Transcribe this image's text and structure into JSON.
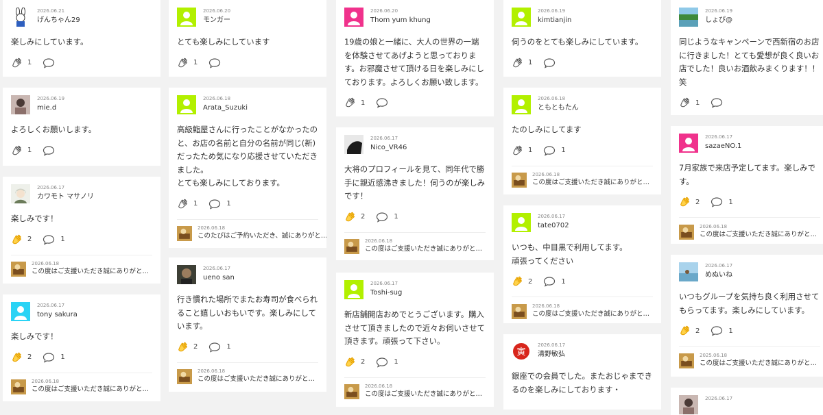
{
  "reply_text": "この度はご支援いただき誠にありがと…",
  "reply_text_alt": "このたびはご予約いただき、誠にありがと…",
  "colors": {
    "accent_lime": "#b2f000",
    "accent_pink": "#f0328c",
    "accent_cyan": "#2ad3f5",
    "clap_active": "#f5b400"
  },
  "posts": [
    {
      "id": "p1",
      "date": "2026.06.21",
      "name": "げんちゃん29",
      "avatar": "bunny-icon",
      "text": "楽しみにしています。",
      "claps": "1",
      "comments": "",
      "reply_date": "",
      "active": false
    },
    {
      "id": "p2",
      "date": "2026.06.19",
      "name": "mie.d",
      "avatar": "photo-avatar",
      "text": "よろしくお願いします。",
      "claps": "1",
      "comments": "",
      "reply_date": "",
      "active": false
    },
    {
      "id": "p3",
      "date": "2026.06.17",
      "name": "カワモト マサノリ",
      "avatar": "anime-avatar",
      "text": "楽しみです！",
      "claps": "2",
      "comments": "1",
      "reply_date": "2026.06.18",
      "active": true
    },
    {
      "id": "p4",
      "date": "2026.06.17",
      "name": "tony sakura",
      "avatar": "cyan-user-icon",
      "text": "楽しみです！",
      "claps": "2",
      "comments": "1",
      "reply_date": "2026.06.18",
      "active": true
    },
    {
      "id": "p5",
      "date": "2026.06.20",
      "name": "モンガー",
      "avatar": "lime-user-icon",
      "text": "とても楽しみにしています",
      "claps": "1",
      "comments": "",
      "reply_date": "",
      "active": false
    },
    {
      "id": "p6",
      "date": "2026.06.18",
      "name": "Arata_Suzuki",
      "avatar": "lime-user-icon",
      "text": "高級鮨屋さんに行ったことがなかったのと、お店の名前と自分の名前が同じ(新)だったため気になり応援させていただきました。\nとても楽しみにしております。",
      "claps": "1",
      "comments": "1",
      "reply_date": "2026.06.18",
      "active": false,
      "alt_reply": true
    },
    {
      "id": "p7",
      "date": "2026.06.17",
      "name": "ueno san",
      "avatar": "photo-avatar-dark",
      "text": "行き慣れた場所でまたお寿司が食べられること嬉しいおもいです。楽しみにしています。",
      "claps": "2",
      "comments": "1",
      "reply_date": "2026.06.18",
      "active": true
    },
    {
      "id": "p8",
      "date": "2026.06.20",
      "name": "Thom yum khung",
      "avatar": "pink-user-icon",
      "text": "19歳の娘と一緒に、大人の世界の一端を体験させてあげようと思っております。お邪魔させて頂ける日を楽しみにしております。よろしくお願い致します。",
      "claps": "1",
      "comments": "",
      "reply_date": "",
      "active": false
    },
    {
      "id": "p9",
      "date": "2026.06.17",
      "name": "Nico_VR46",
      "avatar": "photo-avatar-bw",
      "text": "大将のプロフィールを見て、同年代で勝手に親近感沸きました！伺うのが楽しみです！",
      "claps": "2",
      "comments": "1",
      "reply_date": "2026.06.18",
      "active": true
    },
    {
      "id": "p10",
      "date": "2026.06.17",
      "name": "Toshi-sug",
      "avatar": "lime-user-icon",
      "text": "新店舗開店おめでとうございます。購入させて頂きましたので近々お伺いさせて頂きます。頑張って下さい。",
      "claps": "2",
      "comments": "1",
      "reply_date": "2026.06.18",
      "active": true
    },
    {
      "id": "p11",
      "date": "2026.06.19",
      "name": "kimtianjin",
      "avatar": "lime-user-icon",
      "text": "伺うのをとても楽しみにしています。",
      "claps": "1",
      "comments": "",
      "reply_date": "",
      "active": false
    },
    {
      "id": "p12",
      "date": "2026.06.18",
      "name": "ともともたん",
      "avatar": "lime-user-icon",
      "text": "たのしみにしてます",
      "claps": "1",
      "comments": "1",
      "reply_date": "2026.06.18",
      "active": false
    },
    {
      "id": "p13",
      "date": "2026.06.17",
      "name": "tate0702",
      "avatar": "lime-user-icon",
      "text": "いつも、中目黒で利用してます。\n頑張ってください",
      "claps": "2",
      "comments": "1",
      "reply_date": "2026.06.18",
      "active": true
    },
    {
      "id": "p14",
      "date": "2026.06.17",
      "name": "清野敏弘",
      "avatar": "kanji-avatar",
      "text": "銀座での会員でした。またおじゃまできるのを楽しみにしております・",
      "claps": "",
      "comments": "",
      "reply_date": "",
      "active": false
    },
    {
      "id": "p15",
      "date": "2026.06.19",
      "name": "しょぴ@",
      "avatar": "photo-avatar-nature",
      "text": "同じようなキャンペーンで西新宿のお店に行きました！とても愛想が良く良いお店でした！良いお酒飲みまくります！！笑",
      "claps": "1",
      "comments": "",
      "reply_date": "",
      "active": false
    },
    {
      "id": "p16",
      "date": "2026.06.17",
      "name": "sazaeNO.1",
      "avatar": "pink-user-icon",
      "text": "7月家族で来店予定してます。楽しみです。",
      "claps": "2",
      "comments": "1",
      "reply_date": "2026.06.18",
      "active": true
    },
    {
      "id": "p17",
      "date": "2026.06.17",
      "name": "めぬいね",
      "avatar": "photo-avatar-beach",
      "text": "いつもグループを気持ち良く利用させてもらってます。楽しみにしています。",
      "claps": "2",
      "comments": "1",
      "reply_date": "2025.06.18",
      "active": true
    },
    {
      "id": "p18",
      "date": "2026.06.17",
      "name": "",
      "avatar": "photo-avatar",
      "text": "",
      "claps": "",
      "comments": "",
      "reply_date": "",
      "active": false
    }
  ]
}
